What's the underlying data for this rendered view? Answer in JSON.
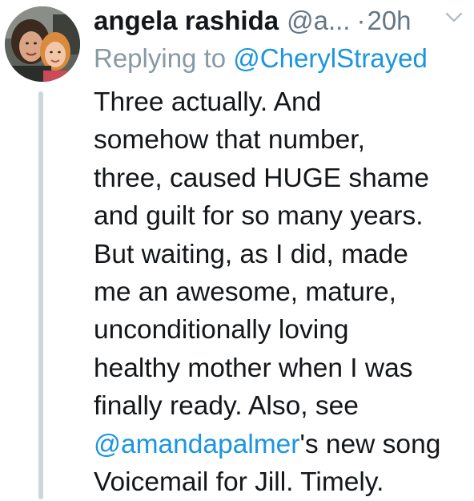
{
  "tweet": {
    "author": {
      "display_name": "angela rashida",
      "handle": "@a...",
      "avatar": "profile-photo"
    },
    "separator": "·",
    "time": "20h",
    "menu_icon": "chevron-down-icon",
    "reply_prefix": "Replying to",
    "reply_to": "@CherylStrayed",
    "body": {
      "line1": "Three actually. And",
      "line2": "somehow that number,",
      "line3": "three, caused HUGE shame",
      "line4": "and guilt for so many years.",
      "line5": "But waiting, as I did, made",
      "line6": "me an awesome, mature,",
      "line7": "unconditionally loving",
      "line8": "healthy mother when I was",
      "line9": "finally ready. Also, see",
      "line10_mention": "@amandapalmer",
      "line10_rest": "'s new song",
      "line11": "Voicemail for Jill. Timely."
    },
    "colors": {
      "text": "#14171a",
      "secondary": "#657786",
      "link": "#1b95e0",
      "thread_line": "#ccd6dd"
    }
  }
}
